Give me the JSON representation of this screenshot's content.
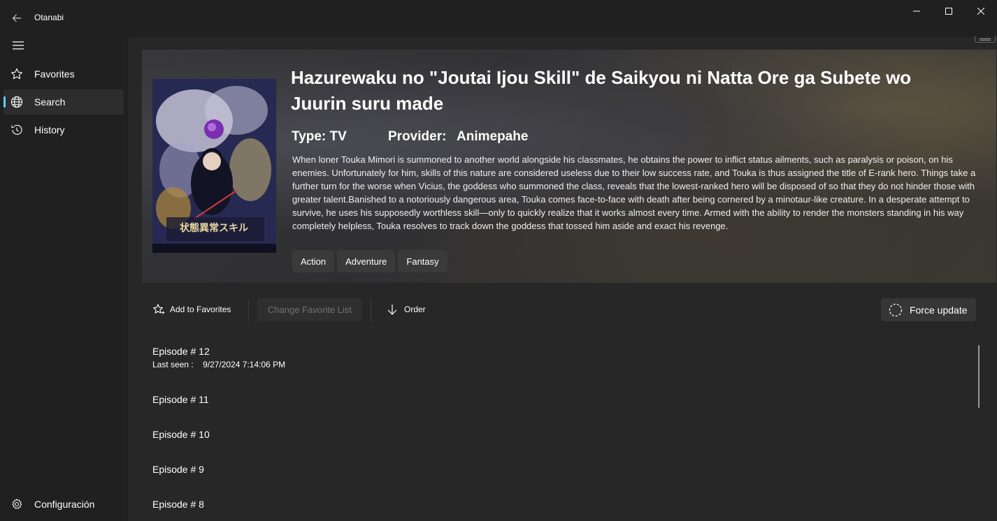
{
  "window": {
    "app_title": "Otanabi"
  },
  "nav": {
    "items": [
      {
        "label": "Favorites",
        "icon": "star-icon",
        "selected": false
      },
      {
        "label": "Search",
        "icon": "globe-icon",
        "selected": true
      },
      {
        "label": "History",
        "icon": "history-icon",
        "selected": false
      }
    ],
    "settings_label": "Configuración"
  },
  "anime": {
    "title": "Hazurewaku no \"Joutai Ijou Skill\" de Saikyou ni Natta Ore ga Subete wo Juurin suru made",
    "type_label": "Type:",
    "type_value": "TV",
    "provider_label": "Provider:",
    "provider_value": "Animepahe",
    "synopsis": "When loner Touka Mimori is summoned to another world alongside his classmates, he obtains the power to inflict status ailments, such as paralysis or poison, on his enemies. Unfortunately for him, skills of this nature are considered useless due to their low success rate, and Touka is thus assigned the title of E-rank hero. Things take a further turn for the worse when Vicius, the goddess who summoned the class, reveals that the lowest-ranked hero will be disposed of so that they do not hinder those with greater talent.Banished to a notoriously dangerous area, Touka comes face-to-face with death after being cornered by a minotaur-like creature. In a desperate attempt to survive, he uses his supposedly worthless skill—only to quickly realize that it works almost every time. Armed with the ability to render the monsters standing in his way completely helpless, Touka resolves to track down the goddess that tossed him aside and exact his revenge.",
    "genres": [
      "Action",
      "Adventure",
      "Fantasy"
    ]
  },
  "toolbar": {
    "add_favorites": "Add to Favorites",
    "change_list": "Change Favorite List",
    "order": "Order",
    "force_update": "Force update"
  },
  "episodes": [
    {
      "title": "Episode # 12",
      "last_seen_label": "Last seen :",
      "last_seen_value": "9/27/2024 7:14:06 PM"
    },
    {
      "title": "Episode # 11"
    },
    {
      "title": "Episode # 10"
    },
    {
      "title": "Episode # 9"
    },
    {
      "title": "Episode # 8"
    }
  ],
  "colors": {
    "accent": "#60cdff",
    "background": "#202020",
    "content_bg": "#272727"
  }
}
